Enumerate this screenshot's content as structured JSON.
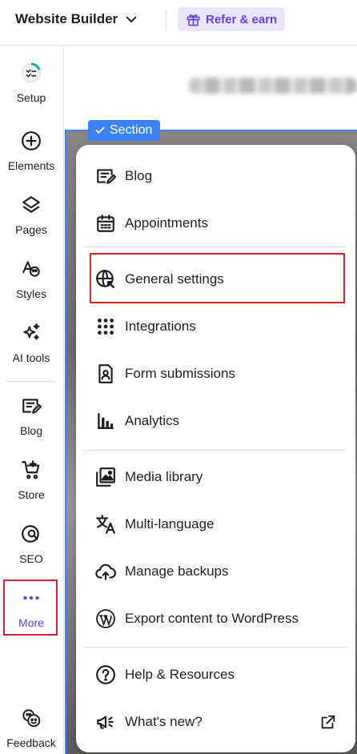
{
  "topbar": {
    "brand_label": "Website Builder",
    "refer_label": "Refer & earn"
  },
  "sidebar": {
    "items": [
      {
        "label": "Setup",
        "icon": "setup-progress-icon"
      },
      {
        "label": "Elements",
        "icon": "plus-circle-icon"
      },
      {
        "label": "Pages",
        "icon": "layers-icon"
      },
      {
        "label": "Styles",
        "icon": "styles-icon"
      },
      {
        "label": "AI tools",
        "icon": "sparkles-icon"
      },
      {
        "label": "Blog",
        "icon": "blog-icon"
      },
      {
        "label": "Store",
        "icon": "cart-icon"
      },
      {
        "label": "SEO",
        "icon": "seo-globe-icon"
      },
      {
        "label": "More",
        "icon": "more-dots-icon"
      },
      {
        "label": "Feedback",
        "icon": "feedback-icon"
      }
    ]
  },
  "canvas": {
    "section_tag": "Section"
  },
  "menu": {
    "items": [
      {
        "label": "Blog",
        "icon": "blog-icon"
      },
      {
        "label": "Appointments",
        "icon": "calendar-icon"
      },
      {
        "label": "General settings",
        "icon": "globe-settings-icon"
      },
      {
        "label": "Integrations",
        "icon": "grid-dots-icon"
      },
      {
        "label": "Form submissions",
        "icon": "form-icon"
      },
      {
        "label": "Analytics",
        "icon": "bar-chart-icon"
      },
      {
        "label": "Media library",
        "icon": "media-icon"
      },
      {
        "label": "Multi-language",
        "icon": "translate-icon"
      },
      {
        "label": "Manage backups",
        "icon": "cloud-backup-icon"
      },
      {
        "label": "Export content to WordPress",
        "icon": "wordpress-icon"
      },
      {
        "label": "Help & Resources",
        "icon": "help-icon"
      },
      {
        "label": "What's new?",
        "icon": "megaphone-icon"
      }
    ]
  },
  "colors": {
    "accent": "#673de6",
    "accent_bg": "#ebe4ff",
    "selection_blue": "#3b82f6",
    "highlight_red": "#d6202a",
    "text": "#1d1e20"
  }
}
